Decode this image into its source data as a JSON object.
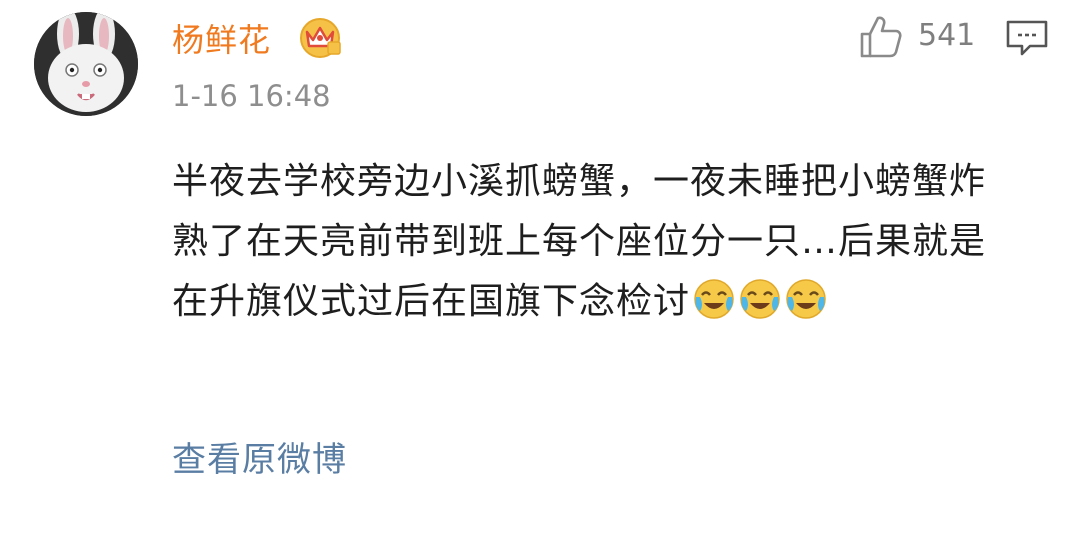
{
  "comment": {
    "username": "杨鲜花",
    "timestamp": "1-16 16:48",
    "likes": "541",
    "text": "半夜去学校旁边小溪抓螃蟹，一夜未睡把小螃蟹炸熟了在天亮前带到班上每个座位分一只…后果就是在升旗仪式过后在国旗下念检讨",
    "emojis": [
      "laugh-cry-icon",
      "laugh-cry-icon",
      "laugh-cry-icon"
    ],
    "view_original_label": "查看原微博"
  },
  "icons": {
    "avatar": "white-rabbit-avatar",
    "badge": "vip-crown-icon",
    "like": "thumbs-up-icon",
    "reply": "comment-bubble-icon"
  },
  "colors": {
    "username": "#f07a1f",
    "link": "#5a7ea3",
    "meta": "#8e8e8e",
    "text": "#1e1e1e"
  }
}
